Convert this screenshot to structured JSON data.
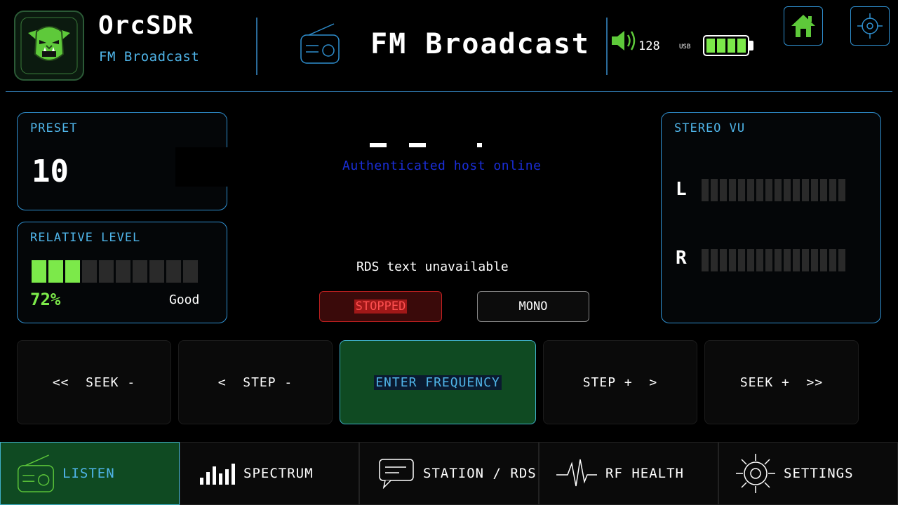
{
  "header": {
    "app_title": "OrcSDR",
    "app_subtitle": "FM Broadcast",
    "mode_title": "FM Broadcast",
    "volume": "128",
    "usb_label": "USB",
    "battery_level": 1.0
  },
  "preset": {
    "label": "PRESET",
    "value": "10"
  },
  "relative_level": {
    "label": "RELATIVE LEVEL",
    "percent": "72%",
    "quality": "Good",
    "bars_total": 10,
    "bars_lit": 3
  },
  "center": {
    "auth_text": "Authenticated host online",
    "rds_text": "RDS text unavailable",
    "status_label": "STOPPED",
    "stereo_mode_label": "MONO"
  },
  "stereo_vu": {
    "label": "STEREO VU",
    "left_label": "L",
    "right_label": "R",
    "left_level": 0,
    "right_level": 0
  },
  "controls": {
    "seek_minus": "<<  SEEK -",
    "step_minus": "<  STEP -",
    "enter_frequency": "ENTER FREQUENCY",
    "step_plus": "STEP +  >",
    "seek_plus": "SEEK +  >>"
  },
  "nav": {
    "listen": "LISTEN",
    "spectrum": "SPECTRUM",
    "station_rds": "STATION / RDS",
    "rf_health": "RF HEALTH",
    "settings": "SETTINGS"
  },
  "colors": {
    "accent_blue": "#2f8fcf",
    "text_blue": "#4fb4e8",
    "good_green": "#7ce94a",
    "active_green": "#0f4a22",
    "stopped_red": "#e82020"
  }
}
